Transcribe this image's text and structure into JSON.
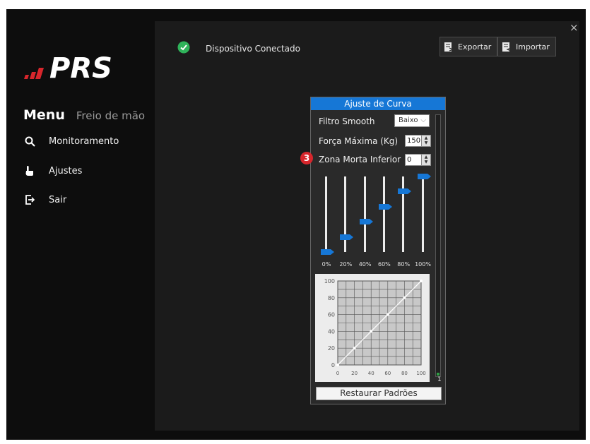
{
  "logo": {
    "text": "PRS"
  },
  "window": {
    "close_label": "×"
  },
  "sidebar": {
    "menu_title": "Menu",
    "menu_subtitle": "Freio de mão",
    "items": [
      {
        "label": "Monitoramento",
        "icon": "search-icon"
      },
      {
        "label": "Ajustes",
        "icon": "hand-pointer-icon"
      },
      {
        "label": "Sair",
        "icon": "logout-icon"
      }
    ]
  },
  "header": {
    "status_text": "Dispositivo Conectado",
    "status_color": "#2fb35a",
    "export_label": "Exportar",
    "import_label": "Importar"
  },
  "curve": {
    "title": "Ajuste de Curva",
    "filter_label": "Filtro Smooth",
    "filter_value": "Baixo",
    "max_force_label": "Força Máxima (Kg)",
    "max_force_value": "150",
    "dead_zone_label": "Zona Morta Inferior",
    "dead_zone_value": "0",
    "step_badge": "3",
    "sliders": [
      {
        "label": "0%",
        "value": 0
      },
      {
        "label": "20%",
        "value": 20
      },
      {
        "label": "40%",
        "value": 40
      },
      {
        "label": "60%",
        "value": 60
      },
      {
        "label": "80%",
        "value": 80
      },
      {
        "label": "100%",
        "value": 100
      }
    ],
    "graph_y_ticks": [
      "100",
      "80",
      "60",
      "40",
      "20",
      "0"
    ],
    "graph_x_ticks": [
      "0",
      "20",
      "40",
      "60",
      "80",
      "100"
    ],
    "level_value": "1",
    "level_fraction": 0.01,
    "restore_label": "Restaurar Padrões",
    "accent_color": "#1677d6"
  }
}
